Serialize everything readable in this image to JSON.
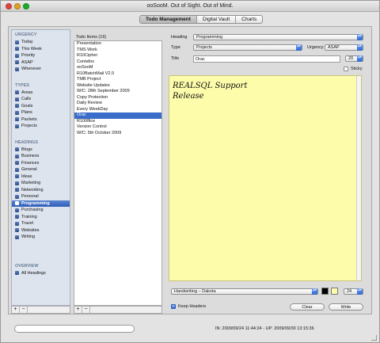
{
  "window": {
    "title": "ooSooM. Out of Sight. Out of Mind."
  },
  "tabs": [
    "Todo Management",
    "Digital Vault",
    "Charts"
  ],
  "sidebar": {
    "urgency": {
      "header": "URGENCY",
      "items": [
        "Today",
        "This Week",
        "Priority",
        "ASAP",
        "Whenever"
      ]
    },
    "types": {
      "header": "TYPES",
      "items": [
        "Areas",
        "Calls",
        "Goals",
        "Plans",
        "Packets",
        "Projects"
      ]
    },
    "headings": {
      "header": "HEADINGS",
      "items": [
        "Blogs",
        "Business",
        "Finances",
        "General",
        "Ideas",
        "Marketing",
        "Networking",
        "Personal",
        "Programming",
        "Purchasing",
        "Training",
        "Travel",
        "Websites",
        "Writing"
      ]
    },
    "overview": {
      "header": "OVERVIEW",
      "items": [
        "All Headings"
      ]
    },
    "add": "+",
    "remove": "−"
  },
  "todo_list": {
    "header": "Todo Items (16)",
    "items": [
      "Presentation",
      "TMS Work",
      "R10Cipher",
      "Contafox",
      "ooSooM",
      "R10BatchMail V2.0",
      "TMB Project",
      "Website Updates",
      "W/C: 28th September 2009",
      "Copy Protection",
      "Daily Review",
      "Every WeekDay",
      "Orac",
      "R100ffice",
      "Version Control",
      "W/C: 5th October 2009"
    ],
    "selected_index": 12,
    "add": "+",
    "remove": "−"
  },
  "detail": {
    "heading_label": "Heading",
    "heading_value": "Programming",
    "type_label": "Type",
    "type_value": "Projects",
    "urgency_label": "Urgency",
    "urgency_value": "ASAP",
    "title_label": "Title",
    "title_value": "Orac",
    "size_value": "20",
    "sticky_label": "Sticky",
    "note_text": "REALSQL Support\nRelease",
    "note_bg_color": "#fdfcab",
    "font_value": "Handwriting – Dakota",
    "font_size_value": "24",
    "swatch_dark": "#000000",
    "swatch_light": "#fdfcab",
    "keep_headers_label": "Keep Headers",
    "clear_label": "Clear",
    "write_label": "Write"
  },
  "status": {
    "text": "IN: 2009/09/24 11:44:24 - UP: 2009/09/30 13:15:36"
  },
  "search": {
    "placeholder": ""
  }
}
